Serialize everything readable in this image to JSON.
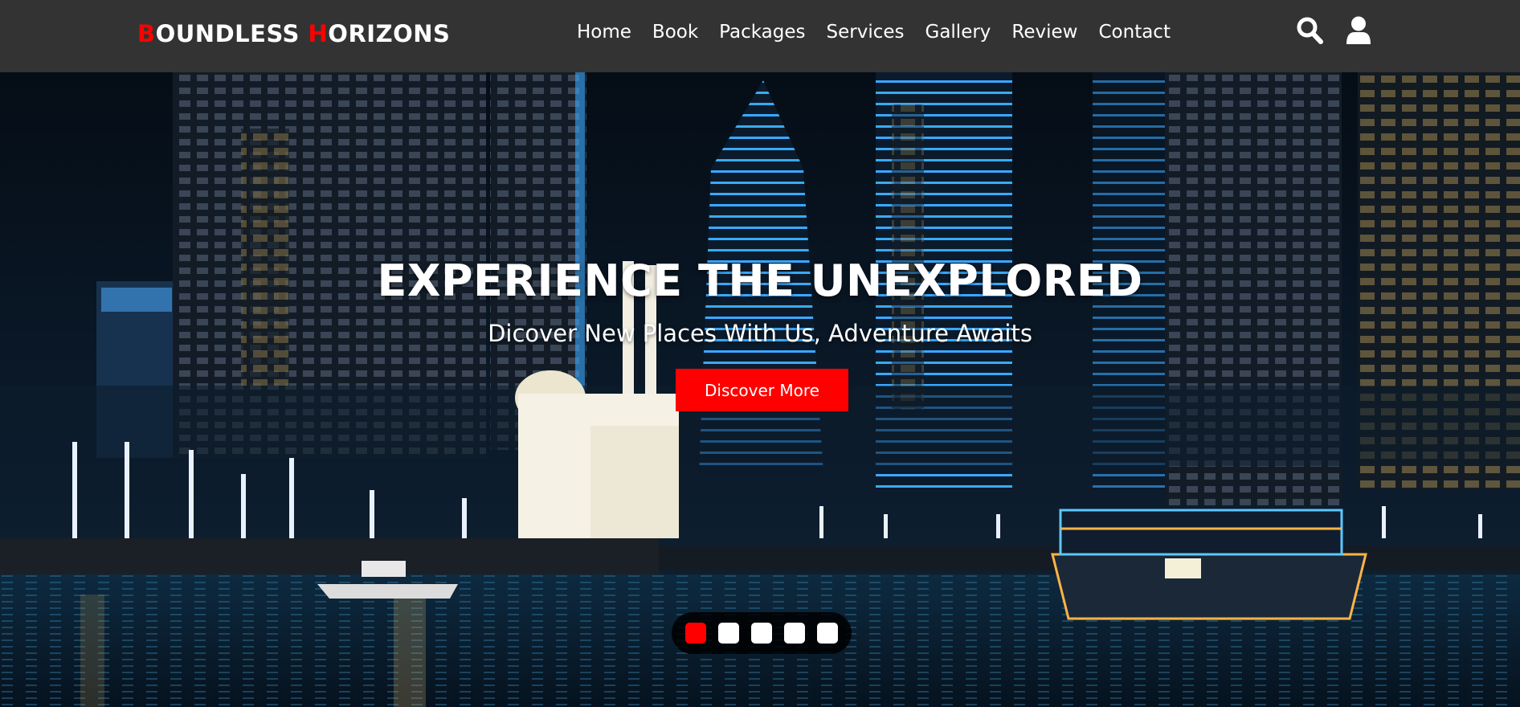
{
  "brand": {
    "first_initial": "B",
    "first_rest": "OUNDLESS ",
    "second_initial": "H",
    "second_rest": "ORIZONS",
    "accent_color": "#ff0000"
  },
  "nav": {
    "items": [
      {
        "label": "Home"
      },
      {
        "label": "Book"
      },
      {
        "label": "Packages"
      },
      {
        "label": "Services"
      },
      {
        "label": "Gallery"
      },
      {
        "label": "Review"
      },
      {
        "label": "Contact"
      }
    ]
  },
  "header_icons": [
    "search-icon",
    "user-icon"
  ],
  "hero": {
    "title": "EXPERIENCE THE UNEXPLORED",
    "subtitle": "Dicover New Places With Us, Adventure Awaits",
    "cta_label": "Discover More",
    "background": "night city skyline with illuminated skyscrapers, mosque and lit dhow boat on water",
    "slides": {
      "count": 5,
      "active": 1
    }
  },
  "colors": {
    "header_bg": "#333333",
    "accent": "#ff0000",
    "text": "#ffffff"
  }
}
